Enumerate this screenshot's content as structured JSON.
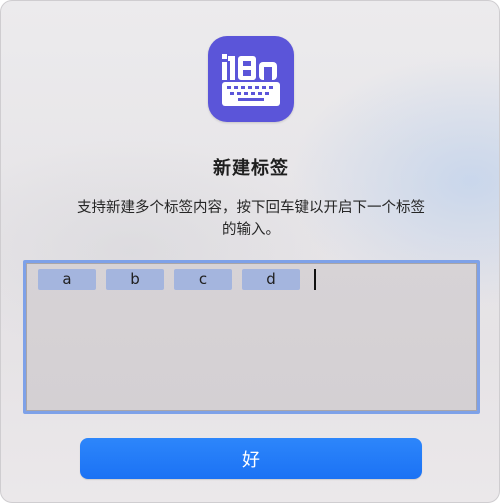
{
  "dialog": {
    "icon_name": "i18n-keyboard-icon",
    "icon_text": "i18n",
    "title": "新建标签",
    "message_line1": "支持新建多个标签内容，按下回车键以开启下一个标签",
    "message_line2": "的输入。",
    "tokens": [
      "a",
      "b",
      "c",
      "d"
    ],
    "ok_label": "好"
  },
  "colors": {
    "icon_background": "#5b55d9",
    "token_background": "#a4b5de",
    "focus_ring": "#7ea1e8",
    "button_accent": "#1b72f4"
  }
}
